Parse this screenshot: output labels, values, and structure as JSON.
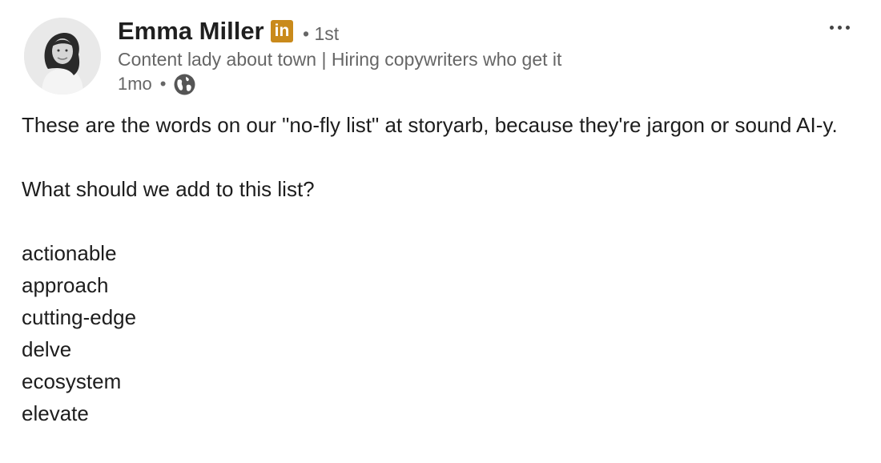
{
  "author": {
    "name": "Emma Miller",
    "badge": "in",
    "degree": "• 1st",
    "headline": "Content lady about town | Hiring copywriters who get it",
    "time": "1mo",
    "separator": "•",
    "visibility_icon": "globe-icon",
    "badge_color": "#c98a1b"
  },
  "menu": {
    "icon": "more-horizontal-icon"
  },
  "post": {
    "intro": "These are the words on our \"no-fly list\" at storyarb, because they're jargon or sound AI-y.",
    "question": "What should we add to this list?",
    "words": [
      "actionable",
      "approach",
      "cutting-edge",
      "delve",
      "ecosystem",
      "elevate"
    ]
  }
}
